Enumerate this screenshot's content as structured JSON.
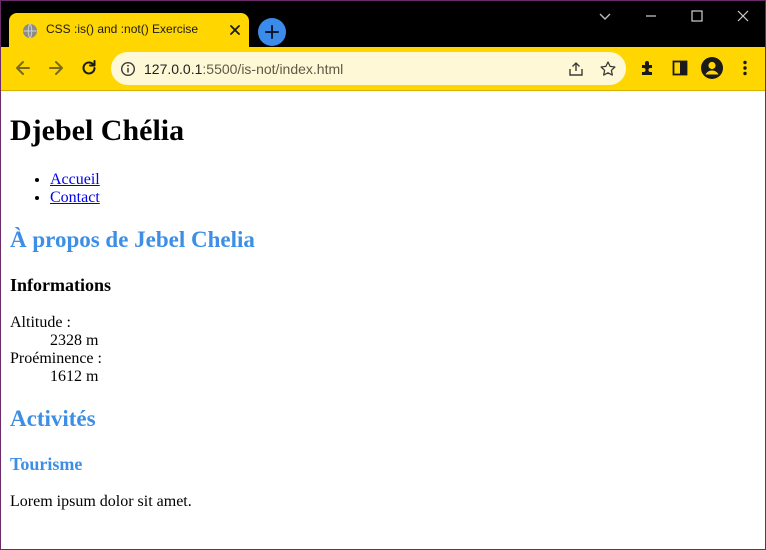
{
  "browser": {
    "tab_title": "CSS :is() and :not() Exercise",
    "url_host": "127.0.0.1",
    "url_path": ":5500/is-not/index.html",
    "accent_color": "#ffd600",
    "newtab_color": "#3b8beb",
    "icons": {
      "favicon": "globe-icon",
      "tab_close": "close-icon",
      "new_tab": "plus-icon",
      "tab_search": "chevron-down-icon",
      "minimize": "minimize-icon",
      "maximize": "maximize-icon",
      "close_window": "close-icon",
      "back": "back-arrow-icon",
      "forward": "forward-arrow-icon",
      "reload": "reload-icon",
      "site_info": "info-icon",
      "share": "share-icon",
      "bookmark": "star-icon",
      "extensions": "puzzle-icon",
      "side_panel": "side-panel-icon",
      "profile": "profile-icon",
      "menu": "kebab-menu-icon"
    }
  },
  "page": {
    "title": "Djebel Chélia",
    "nav": [
      "Accueil",
      "Contact"
    ],
    "about_heading": "À propos de Jebel Chelia",
    "info_heading": "Informations",
    "info": [
      {
        "term": "Altitude :",
        "value": "2328 m"
      },
      {
        "term": "Proéminence :",
        "value": "1612 m"
      }
    ],
    "activities_heading": "Activités",
    "tourism_heading": "Tourisme",
    "paragraph": "Lorem ipsum dolor sit amet.",
    "heading_color": "#3d8fe6",
    "link_color": "#0000ee"
  }
}
